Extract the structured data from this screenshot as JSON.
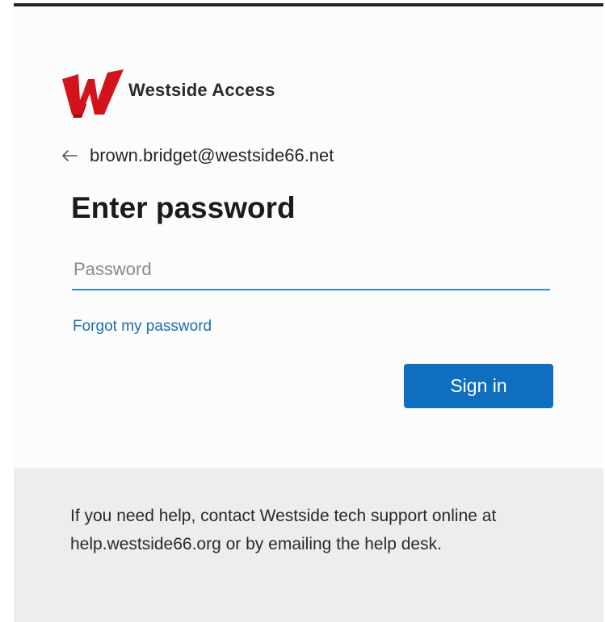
{
  "brand": {
    "name": "Westside Access",
    "logo_icon": "w-logo-icon",
    "logo_color": "#d3131b"
  },
  "identity": {
    "back_icon": "arrow-left-icon",
    "email": "brown.bridget@westside66.net"
  },
  "form": {
    "title": "Enter password",
    "password_placeholder": "Password",
    "password_value": "",
    "forgot_link": "Forgot my password",
    "signin_label": "Sign in"
  },
  "help": {
    "text": "If you need help, contact Westside tech support online at help.westside66.org or by emailing the help desk."
  },
  "colors": {
    "accent": "#106ebe",
    "link": "#1c6fa8",
    "input_underline": "#3d8ab6",
    "help_background": "#eeedee"
  }
}
